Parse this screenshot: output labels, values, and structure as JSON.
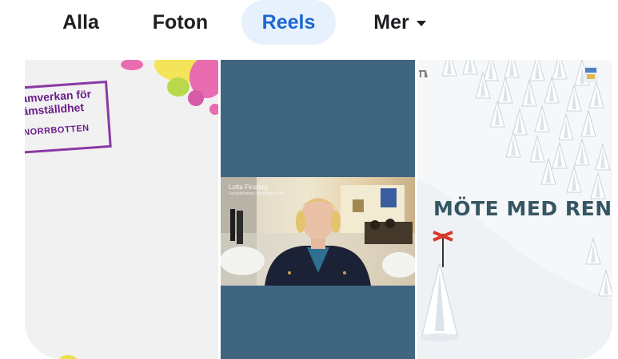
{
  "tabs": [
    {
      "label": "Alla",
      "active": false
    },
    {
      "label": "Foton",
      "active": false
    },
    {
      "label": "Reels",
      "active": true
    },
    {
      "label": "Mer",
      "active": false,
      "has_dropdown": true
    }
  ],
  "colors": {
    "active_tab_bg": "#e7f1fd",
    "active_tab_text": "#1b66d2",
    "text": "#1c1e21"
  },
  "reels": [
    {
      "stamp": {
        "line1": "amverkan för",
        "line2": "ämställdhet",
        "line3": "NORRBOTTEN"
      }
    },
    {
      "video": {
        "speaker_name": "Lotta Finstorp",
        "speaker_title": "Landshövding i Norrbottens län"
      }
    },
    {
      "title": "MÖTE MED REN"
    }
  ]
}
